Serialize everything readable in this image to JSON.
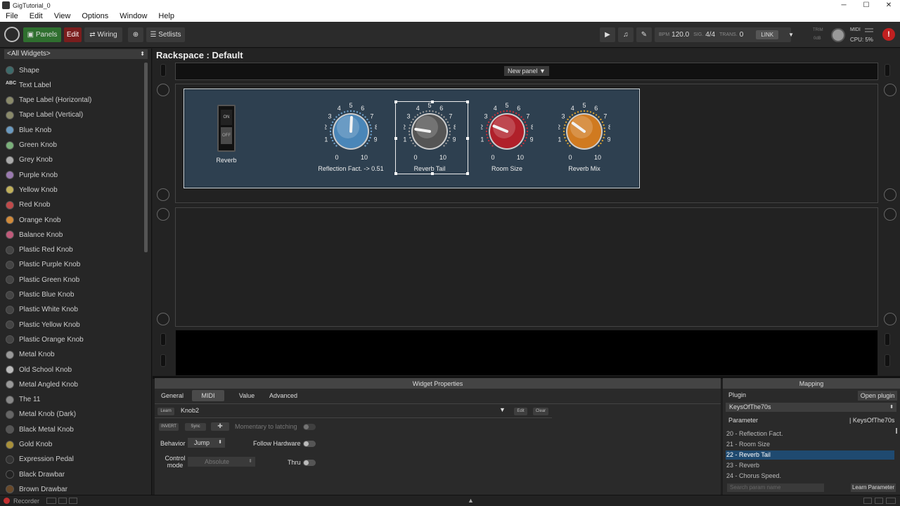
{
  "window": {
    "title": "GigTutorial_0",
    "min": "─",
    "max": "☐",
    "close": "✕"
  },
  "menu": [
    "File",
    "Edit",
    "View",
    "Options",
    "Window",
    "Help"
  ],
  "toolbar": {
    "panels": "Panels",
    "edit": "Edit",
    "wiring": "Wiring",
    "setlists": "Setlists",
    "bpm_label": "BPM",
    "bpm": "120.0",
    "sig_label": "SIG.",
    "sig": "4/4",
    "trans_label": "TRANS.",
    "trans": "0",
    "link": "LINK",
    "trim_label": "TRIM",
    "trim_value": "0dB",
    "midi": "MIDI",
    "cpu": "CPU: 5%"
  },
  "sidebar": {
    "filter": "<All Widgets>",
    "items": [
      {
        "label": "Shape",
        "color": "#3d6b6b"
      },
      {
        "label": "Text Label",
        "icon": "ABC"
      },
      {
        "label": "Tape Label (Horizontal)",
        "color": "#8a8a6a"
      },
      {
        "label": "Tape Label (Vertical)",
        "color": "#8a8a6a"
      },
      {
        "label": "Blue Knob",
        "color": "#6a9ac0"
      },
      {
        "label": "Green Knob",
        "color": "#7ab07a"
      },
      {
        "label": "Grey Knob",
        "color": "#aaaaaa"
      },
      {
        "label": "Purple Knob",
        "color": "#9a7ab0"
      },
      {
        "label": "Yellow Knob",
        "color": "#c0b05a"
      },
      {
        "label": "Red Knob",
        "color": "#c04a4a"
      },
      {
        "label": "Orange Knob",
        "color": "#d08a3a"
      },
      {
        "label": "Balance Knob",
        "color": "#c05a7a"
      },
      {
        "label": "Plastic Red Knob",
        "color": "#444"
      },
      {
        "label": "Plastic Purple Knob",
        "color": "#444"
      },
      {
        "label": "Plastic Green Knob",
        "color": "#444"
      },
      {
        "label": "Plastic Blue Knob",
        "color": "#444"
      },
      {
        "label": "Plastic White Knob",
        "color": "#444"
      },
      {
        "label": "Plastic Yellow Knob",
        "color": "#444"
      },
      {
        "label": "Plastic Orange Knob",
        "color": "#444"
      },
      {
        "label": "Metal Knob",
        "color": "#999"
      },
      {
        "label": "Old School Knob",
        "color": "#bbb"
      },
      {
        "label": "Metal Angled Knob",
        "color": "#999"
      },
      {
        "label": "The 11",
        "color": "#888"
      },
      {
        "label": "Metal Knob (Dark)",
        "color": "#666"
      },
      {
        "label": "Black Metal Knob",
        "color": "#555"
      },
      {
        "label": "Gold Knob",
        "color": "#a8903a"
      },
      {
        "label": "Expression Pedal",
        "color": "#333"
      },
      {
        "label": "Black Drawbar",
        "color": "#222"
      },
      {
        "label": "Brown Drawbar",
        "color": "#6a4a2a"
      }
    ]
  },
  "rackspace": {
    "title": "Rackspace : Default",
    "new_panel": "New panel",
    "switch": {
      "on": "ON",
      "off": "OFF",
      "label": "Reverb"
    },
    "knobs": [
      {
        "label": "Reflection Fact. -> 0.51",
        "color": "#4a86b8",
        "ring": "#6fa3cf",
        "value": 0.51
      },
      {
        "label": "Reverb Tail",
        "color": "#555555",
        "ring": "#9a9a9a",
        "value": 0.2
      },
      {
        "label": "Room Size",
        "color": "#b0202a",
        "ring": "#c8303a",
        "value": 0.25
      },
      {
        "label": "Reverb Mix",
        "color": "#d07a20",
        "ring": "#d8a030",
        "value": 0.3
      }
    ]
  },
  "widget_props": {
    "title": "Widget Properties",
    "tabs": [
      "General",
      "MIDI",
      "Value",
      "Advanced"
    ],
    "learn": "Learn",
    "knob_name": "Knob2",
    "edit": "Edit",
    "clear": "Clear",
    "invert": "INVERT",
    "sync": "Sync",
    "momentary": "Momentary to latching",
    "behavior_label": "Behavior",
    "behavior_value": "Jump",
    "follow_hardware": "Follow Hardware",
    "control_mode_label": "Control mode",
    "control_mode_value": "Absolute",
    "thru": "Thru"
  },
  "mapping": {
    "title": "Mapping",
    "plugin_label": "Plugin",
    "open_plugin": "Open plugin",
    "plugin_value": "KeysOfThe70s",
    "param_col": "Parameter",
    "plugin_col": "| KeysOfThe70s",
    "params": [
      "20 - Reflection Fact.",
      "21 - Room Size",
      "22 - Reverb Tail",
      "23 - Reverb",
      "24 - Chorus Speed."
    ],
    "search_placeholder": "Search param name",
    "learn_param": "Learn Parameter"
  },
  "status": {
    "recorder": "Recorder"
  }
}
